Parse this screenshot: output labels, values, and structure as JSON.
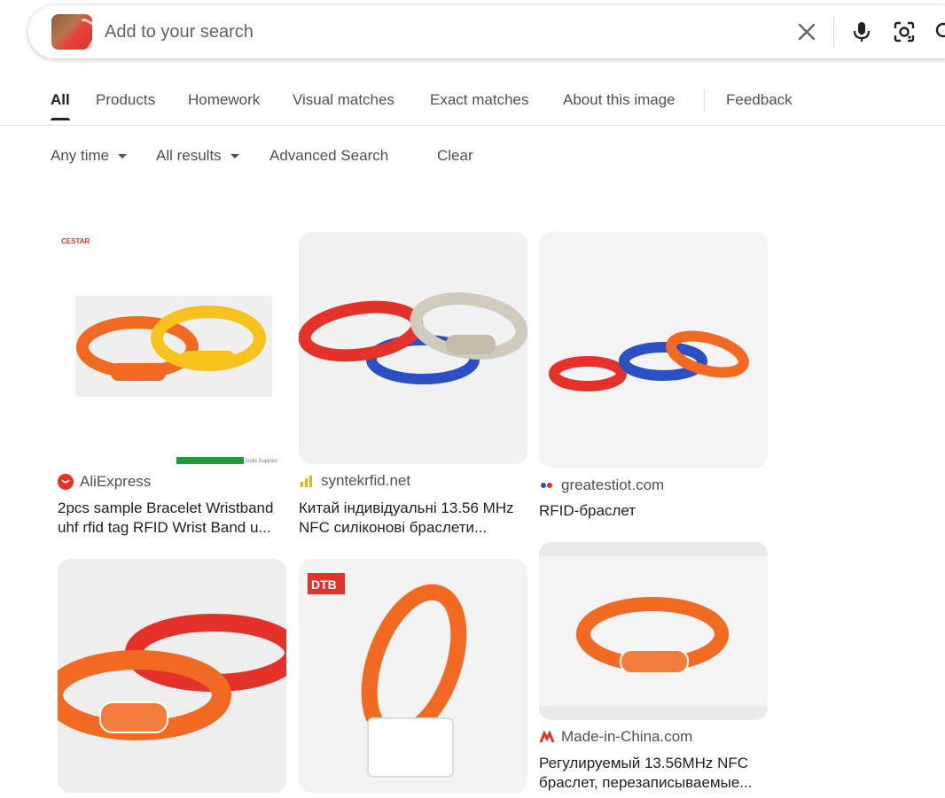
{
  "search": {
    "placeholder": "Add to your search"
  },
  "tabs": [
    {
      "label": "All",
      "active": true
    },
    {
      "label": "Products"
    },
    {
      "label": "Homework"
    },
    {
      "label": "Visual matches"
    },
    {
      "label": "Exact matches"
    },
    {
      "label": "About this image"
    },
    {
      "label": "Feedback"
    }
  ],
  "filters": {
    "time": "Any time",
    "results": "All results",
    "advanced": "Advanced Search",
    "clear": "Clear"
  },
  "results": [
    {
      "source": "AliExpress",
      "title_line1": "2pcs sample Bracelet Wristband",
      "title_line2": "uhf rfid tag RFID Wrist Band u...",
      "image_brand": "CESTAR",
      "image_badge": "Gold Supplier",
      "favicon": "aliexpress-icon"
    },
    {
      "source": "syntekrfid.net",
      "title_line1": "Китай індивідуальні 13.56 MHz",
      "title_line2": "NFC силіконові браслети...",
      "favicon": "syntek-icon"
    },
    {
      "source": "greatestiot.com",
      "title_line1": "RFID-браслет",
      "title_line2": "",
      "favicon": "greatestiot-icon"
    },
    {
      "source": "",
      "title_line1": "",
      "title_line2": ""
    },
    {
      "source": "",
      "title_line1": "",
      "title_line2": "",
      "image_brand": "DTB"
    },
    {
      "source": "Made-in-China.com",
      "title_line1": "Регулируемый 13.56MHz NFC",
      "title_line2": "браслет, перезаписываемые...",
      "favicon": "made-in-china-icon"
    }
  ],
  "colors": {
    "orange": "#f26a21",
    "yellow": "#f7c21b",
    "red": "#e4322b",
    "blue": "#2b4fc4",
    "grey": "#cfcbbd"
  }
}
